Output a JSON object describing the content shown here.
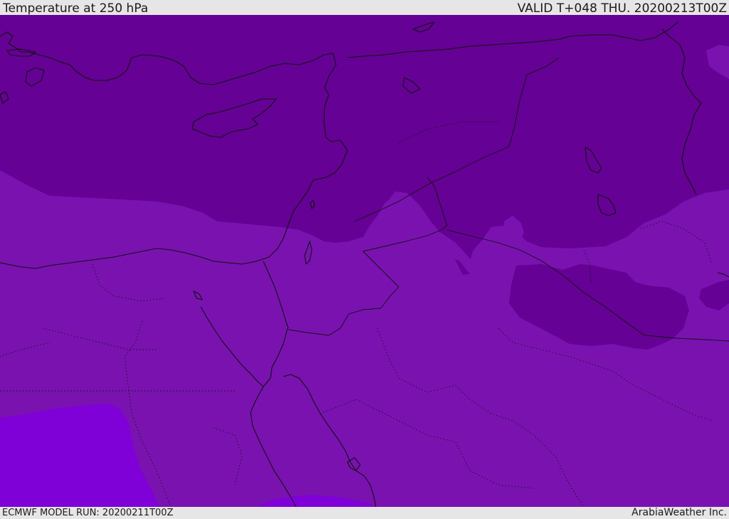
{
  "header": {
    "title": "Temperature at 250 hPa",
    "valid": "VALID T+048 THU. 20200213T00Z"
  },
  "footer": {
    "model_run": "ECMWF MODEL RUN: 20200211T00Z",
    "credit": "ArabiaWeather Inc."
  },
  "map": {
    "colors": {
      "coldest_band": "#650194",
      "mid_band": "#7a12b0",
      "warmest_band": "#8000d8",
      "coastline": "#111111",
      "border": "#111111"
    }
  }
}
